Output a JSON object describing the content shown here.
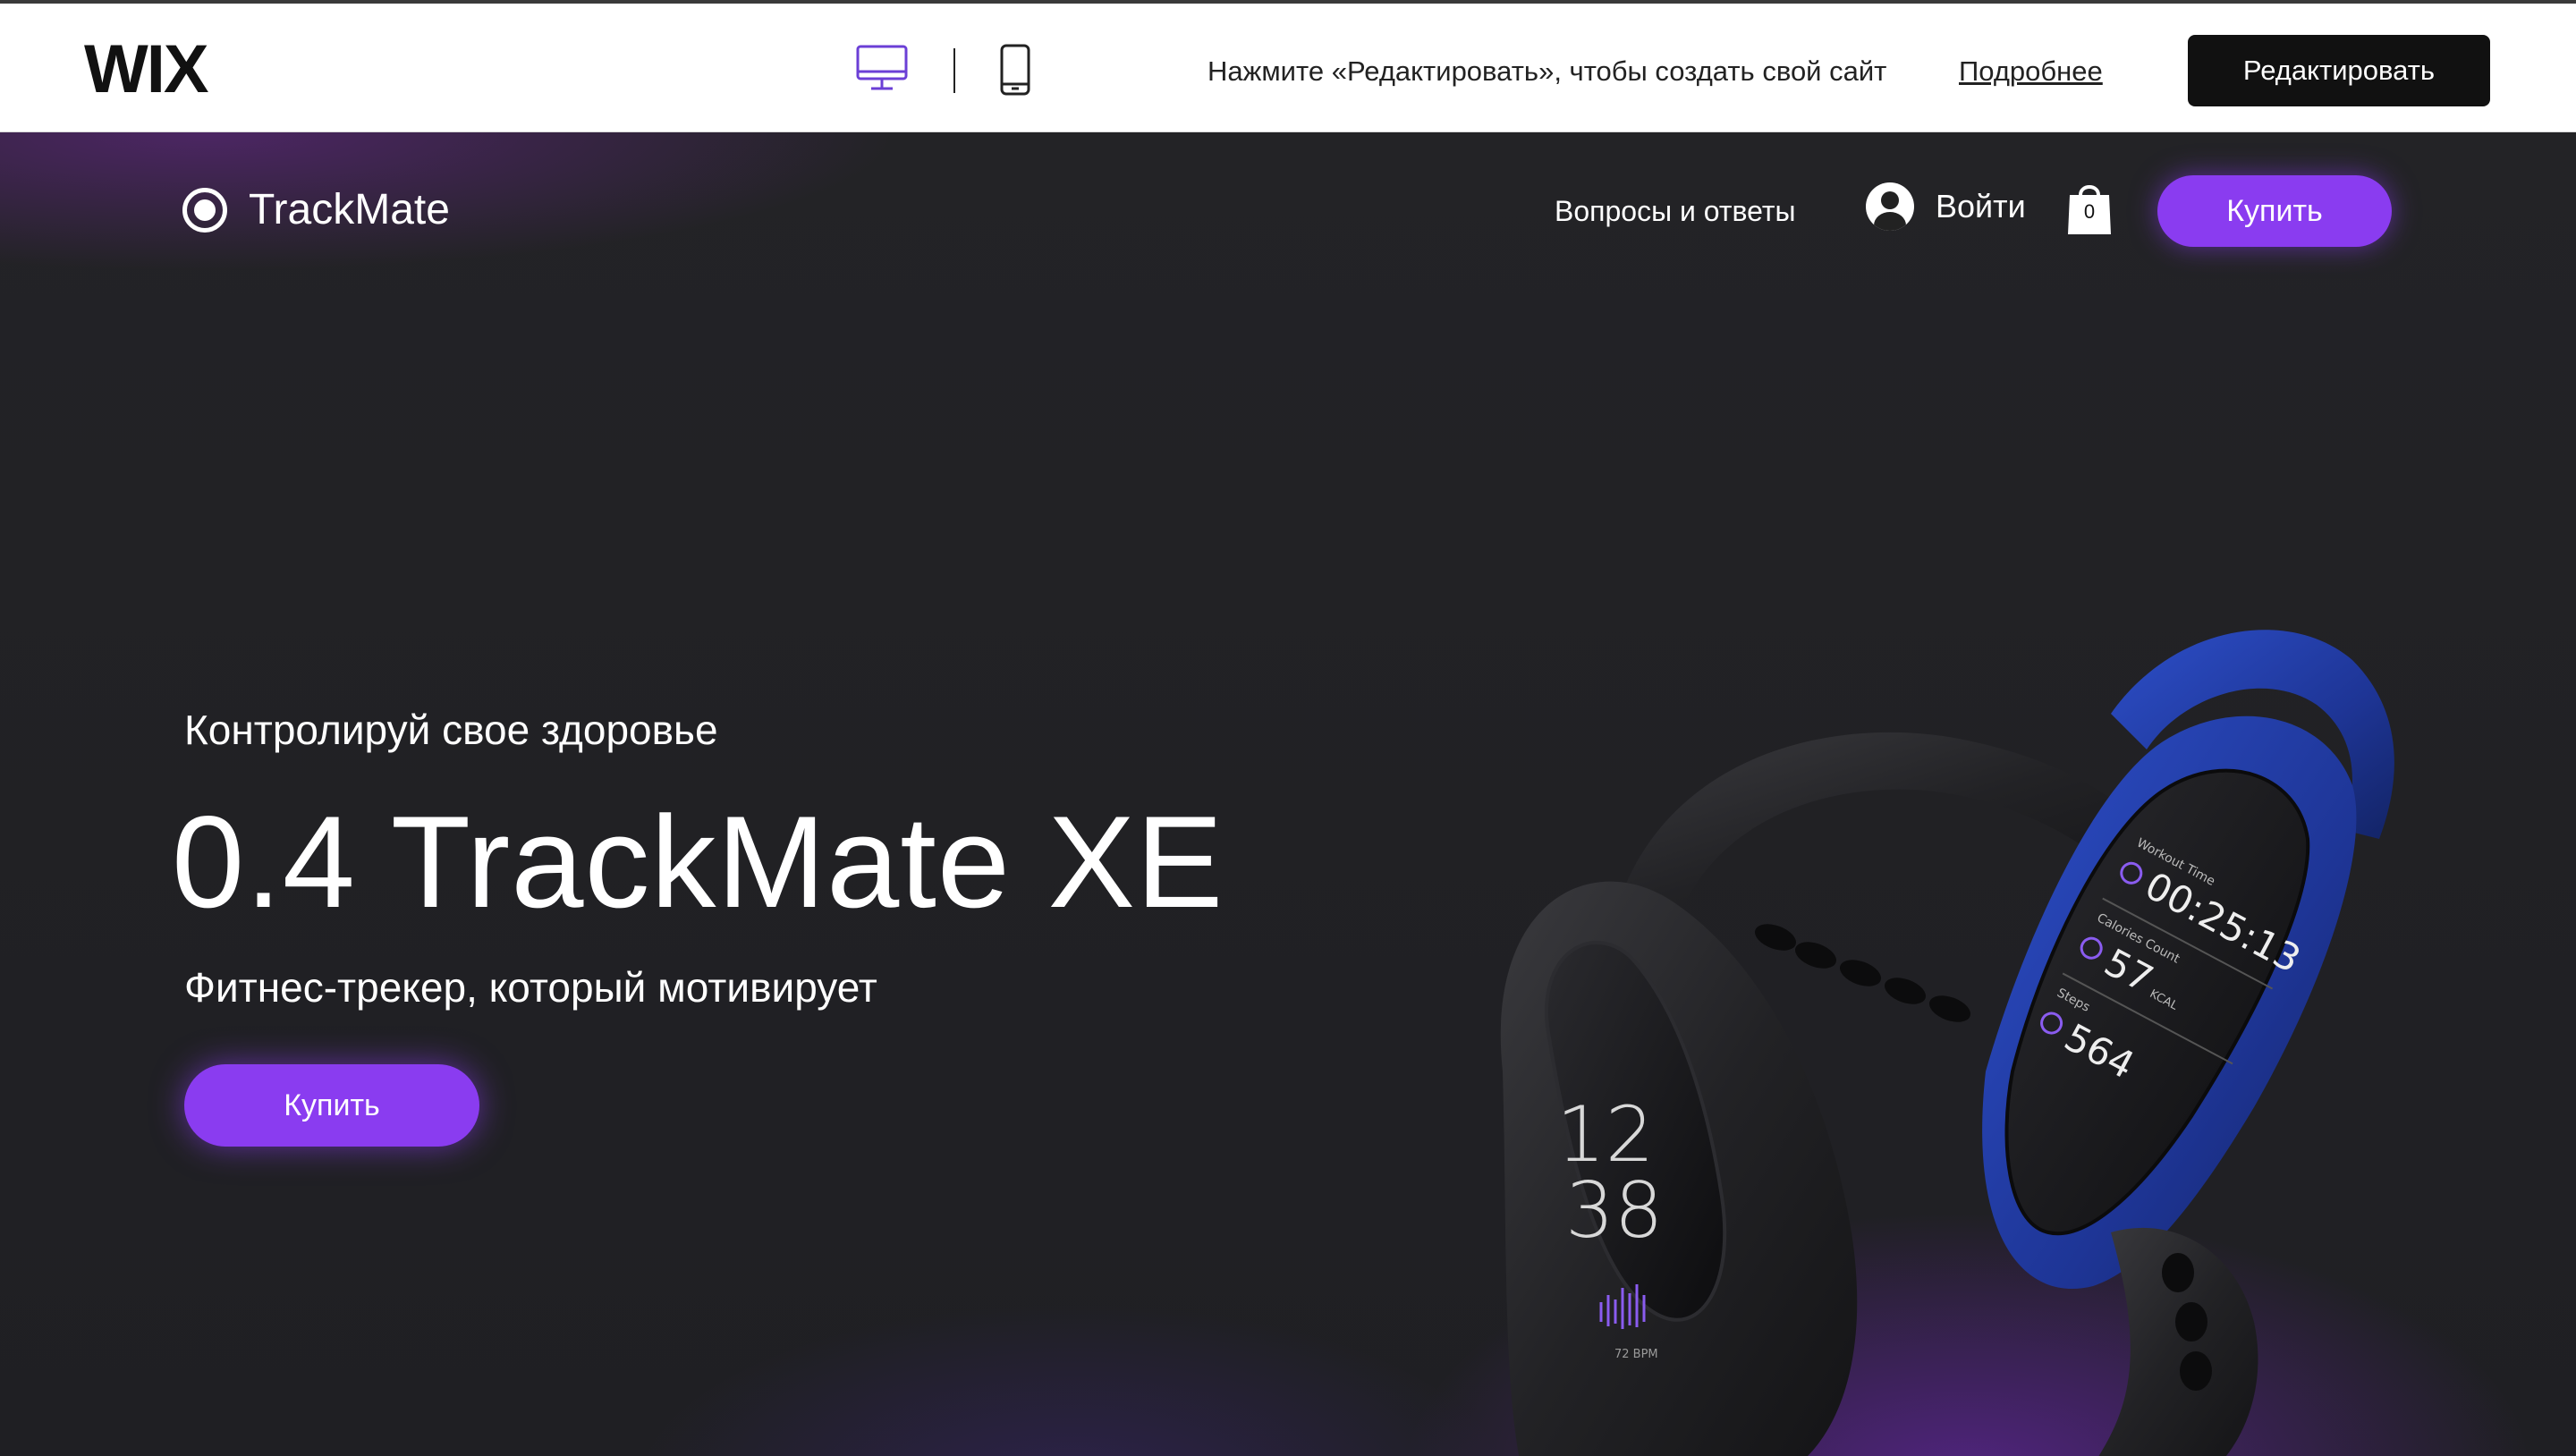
{
  "wix_bar": {
    "logo": "WIX",
    "hint": "Нажмите «Редактировать», чтобы создать свой сайт",
    "learn_more": "Подробнее",
    "edit_button": "Редактировать",
    "desktop_icon": "desktop-icon",
    "mobile_icon": "mobile-icon",
    "active_view": "desktop",
    "accent_color": "#6b3fd6"
  },
  "site_header": {
    "brand_name": "TrackMate",
    "nav_faq": "Вопросы и ответы",
    "login_label": "Войти",
    "cart_count": "0",
    "buy_button": "Купить"
  },
  "hero": {
    "subtitle": "Контролируй свое здоровье",
    "title": "0.4 TrackMate XE",
    "description": "Фитнес-трекер, который мотивирует",
    "buy_button": "Купить"
  },
  "product_image": {
    "black_band": {
      "hour": "12",
      "minute": "38",
      "bpm": "72 BPM"
    },
    "blue_band": {
      "workout_label": "Workout Time",
      "workout_value": "00:25:13",
      "calories_label": "Calories Count",
      "calories_value": "57",
      "calories_unit": "KCAL",
      "steps_label": "Steps",
      "steps_value": "564"
    }
  },
  "colors": {
    "site_bg": "#1e1e22",
    "buy_purple": "#8a3cf0",
    "band_blue": "#1f3a9e",
    "band_black": "#1a1a1c"
  }
}
